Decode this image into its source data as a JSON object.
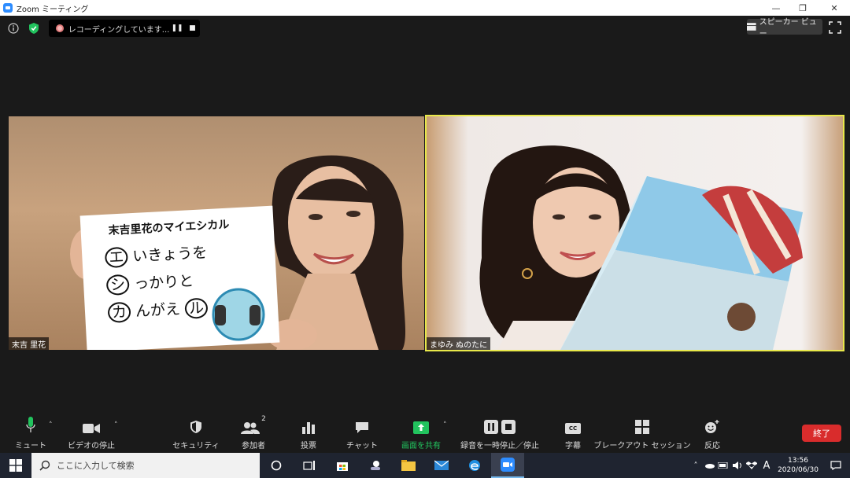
{
  "window": {
    "title": "Zoom ミーティング"
  },
  "status": {
    "recording_text": "レコーディングしています...",
    "view_label": "スピーカー ビュー"
  },
  "participants": [
    {
      "name": "末吉 里花"
    },
    {
      "name": "まゆみ ぬのたに"
    }
  ],
  "whiteboard": {
    "title": "末吉里花のマイエシカル",
    "line1_circle": "エ",
    "line1_rest": "いきょうを",
    "line2_circle": "シ",
    "line2_rest": "っかりと",
    "line3_circle": "カ",
    "line3_rest": "んがえ",
    "line3_end": "ル"
  },
  "toolbar": {
    "mute": "ミュート",
    "video": "ビデオの停止",
    "security": "セキュリティ",
    "participants": "参加者",
    "participants_count": "2",
    "polls": "投票",
    "chat": "チャット",
    "share": "画面を共有",
    "record": "録音を一時停止／停止",
    "captions": "字幕",
    "breakout": "ブレークアウト セッション",
    "reactions": "反応",
    "end": "終了",
    "cc_badge": "CC"
  },
  "taskbar": {
    "search_placeholder": "ここに入力して検索",
    "time": "13:56",
    "date": "2020/06/30",
    "ime": "A"
  },
  "colors": {
    "active_speaker_border": "#e8e84a",
    "end_button": "#d92c2c",
    "share_green": "#22c35e",
    "zoom_blue": "#2d8cff"
  }
}
